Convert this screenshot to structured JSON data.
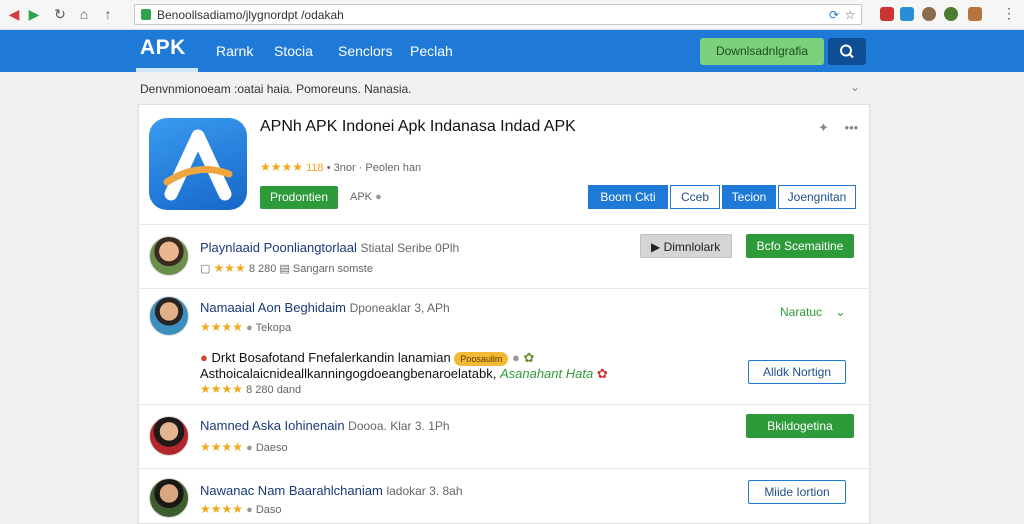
{
  "browser": {
    "url": "Benoollsadiamo/jlygnordpt /odakah",
    "menu_glyph": "⋮"
  },
  "nav": {
    "logo": "APK",
    "links": [
      "Rarnk",
      "Stocia",
      "Senclors",
      "Peclah"
    ],
    "download_label": "Downlsadnlgrafia"
  },
  "notice": {
    "text": "Denvnmionoeam :oatai haia.  Pomoreuns.  Nanasia."
  },
  "app": {
    "title": "APNh APK Indonei Apk Indanasa Indad APK",
    "stars": "★★★★",
    "rating": "118",
    "rating_meta": "•  3nor  ·  Peolen han",
    "install_label": "Prodontien",
    "apk_label": "APK",
    "actions": [
      "Boom Ckti",
      "Cceb",
      "Tecion",
      "Joengnitan"
    ]
  },
  "rows": [
    {
      "title": "Playnlaaid Poonliangtorlaal",
      "subtitle": "Stiatal Seribe  0Plh",
      "stars": "★★★",
      "meta": "8 280",
      "meta2": "Sangarn somste",
      "secondary_button": "Dimnlolark",
      "primary_button": "Bcfo Scemaitine"
    },
    {
      "title": "Namaaial Aon Beghidaim",
      "subtitle": "Dponeaklar 3, APh",
      "stars": "★★★★",
      "meta": "Tekopa",
      "expand_label": "Naratuc"
    },
    {
      "title": "",
      "note_line_1": "Drkt Bosafotand Fnefalerkandin lanamian",
      "note_tag": "Poosaulim",
      "note_line_2": "Asthoicalaicnideallkanningogdoeangbenaroelatabk,",
      "note_highlight": "Asanahant Hata",
      "stars": "★★★★",
      "meta": "8 280",
      "meta2": "dand",
      "outline_button": "Alldk Nortign"
    },
    {
      "title": "Namned Aska Iohinenain",
      "subtitle": "Doooa. Klar 3. 1Ph",
      "stars": "★★★★",
      "meta": "Daeso",
      "primary_button": "Bkildogetina"
    },
    {
      "title": "Nawanac Nam Baarahlchaniam",
      "subtitle": "ladokar 3. 8ah",
      "stars": "★★★★",
      "meta": "Daso",
      "outline_button": "Miide Iortion"
    }
  ],
  "colors": {
    "brand_blue": "#1e7ad6",
    "green": "#2e9b3a",
    "star": "#f2a81d"
  }
}
